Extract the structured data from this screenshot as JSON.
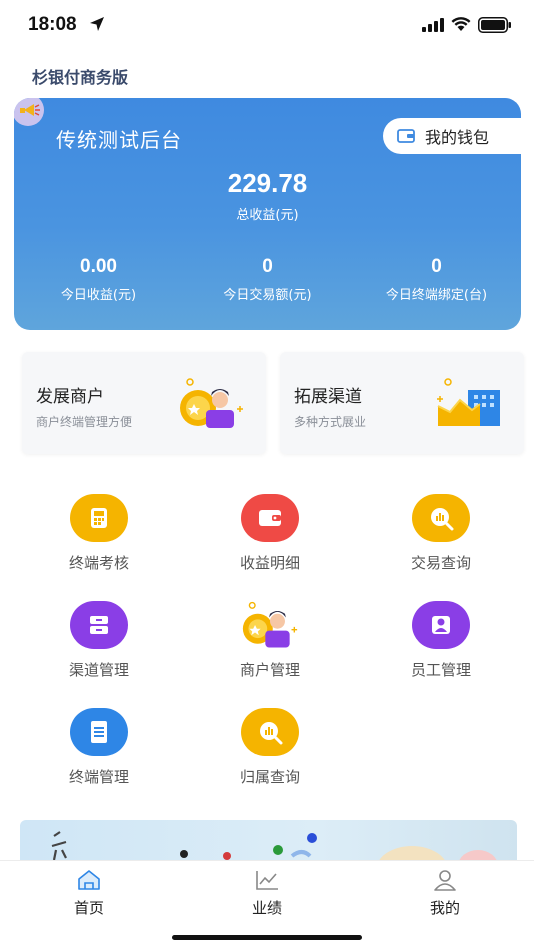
{
  "status_bar": {
    "time": "18:08"
  },
  "app": {
    "title": "杉银付商务版"
  },
  "summary_card": {
    "org_name": "传统测试后台",
    "wallet_label": "我的钱包",
    "total_value": "229.78",
    "total_label": "总收益(元)",
    "stats": [
      {
        "value": "0.00",
        "label": "今日收益(元)"
      },
      {
        "value": "0",
        "label": "今日交易额(元)"
      },
      {
        "value": "0",
        "label": "今日终端绑定(台)"
      }
    ]
  },
  "promo_tiles": [
    {
      "title": "发展商户",
      "subtitle": "商户终端管理方便"
    },
    {
      "title": "拓展渠道",
      "subtitle": "多种方式展业"
    }
  ],
  "menu": [
    {
      "label": "终端考核",
      "icon": "terminal-icon",
      "color": "#f5b400"
    },
    {
      "label": "收益明细",
      "icon": "wallet-icon",
      "color": "#ef4a45"
    },
    {
      "label": "交易查询",
      "icon": "chart-search-icon",
      "color": "#f5b400"
    },
    {
      "label": "渠道管理",
      "icon": "drawer-icon",
      "color": "#8a3ee6"
    },
    {
      "label": "商户管理",
      "icon": "merchant-icon",
      "color": "#f5b400"
    },
    {
      "label": "员工管理",
      "icon": "employee-icon",
      "color": "#8a3ee6"
    },
    {
      "label": "终端管理",
      "icon": "document-icon",
      "color": "#2e86e6"
    },
    {
      "label": "归属查询",
      "icon": "chart-search-icon",
      "color": "#f5b400"
    }
  ],
  "tabs": [
    {
      "label": "首页",
      "icon": "home-icon",
      "active": true
    },
    {
      "label": "业绩",
      "icon": "trend-icon",
      "active": false
    },
    {
      "label": "我的",
      "icon": "profile-icon",
      "active": false
    }
  ],
  "colors": {
    "primary": "#3f8ae0",
    "tab_active": "#2e86e6"
  }
}
